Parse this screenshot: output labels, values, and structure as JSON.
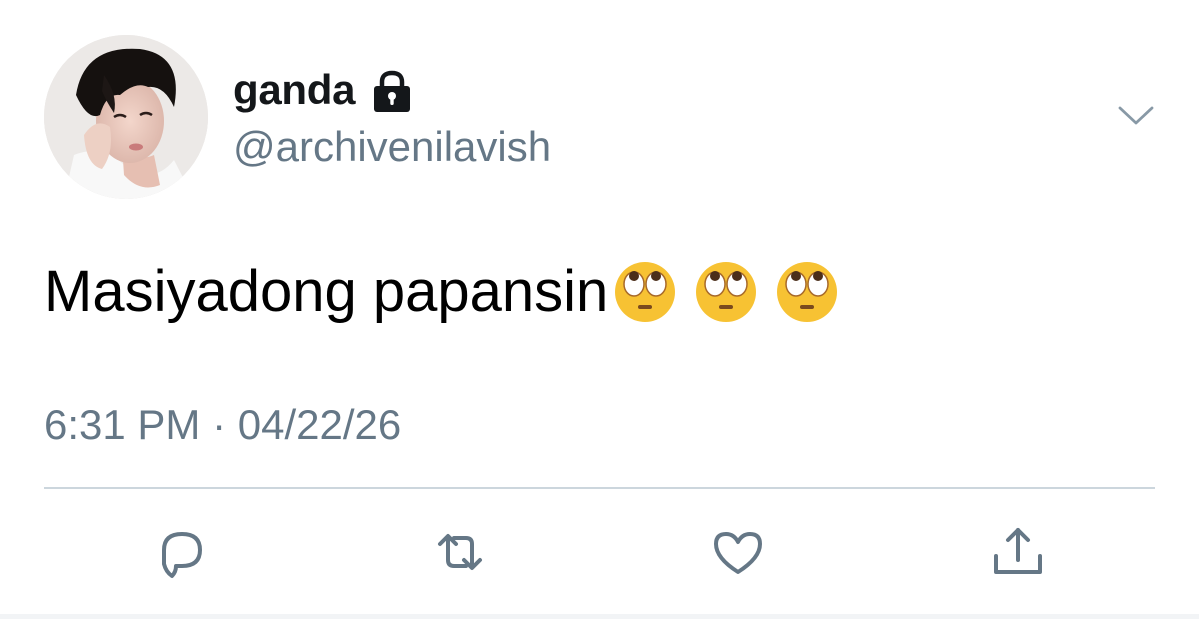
{
  "author": {
    "display_name": "ganda",
    "handle": "@archivenilavish",
    "protected_icon": "lock-icon",
    "avatar": "profile-photo"
  },
  "tweet": {
    "text": "Masiyadong papansin",
    "emojis": [
      "eye-roll-emoji",
      "eye-roll-emoji",
      "eye-roll-emoji"
    ],
    "timestamp": "6:31 PM · 04/22/26"
  },
  "menu": {
    "icon": "chevron-down-icon"
  },
  "actions": [
    {
      "name": "reply",
      "icon": "reply-icon"
    },
    {
      "name": "retweet",
      "icon": "retweet-icon"
    },
    {
      "name": "like",
      "icon": "heart-icon"
    },
    {
      "name": "share",
      "icon": "share-icon"
    }
  ],
  "colors": {
    "secondary_text": "#657786",
    "divider": "#ccd6dd",
    "icon": "#657786",
    "emoji_face": "#f7c233"
  }
}
